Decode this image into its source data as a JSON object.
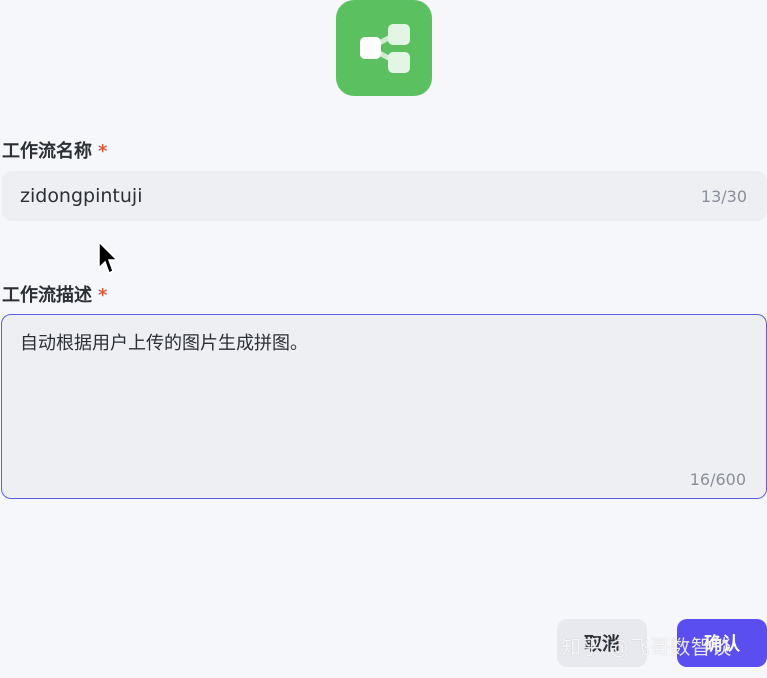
{
  "app_icon": {
    "name": "workflow-icon",
    "color": "#5ac060"
  },
  "workflow_name": {
    "label": "工作流名称",
    "required_mark": "*",
    "value": "zidongpintuji",
    "counter": "13/30"
  },
  "workflow_description": {
    "label": "工作流描述",
    "required_mark": "*",
    "value": "自动根据用户上传的图片生成拼图。",
    "counter": "16/600"
  },
  "buttons": {
    "cancel_label": "取消",
    "confirm_label": "确认"
  },
  "watermark": "知乎 @飞哥数智谈",
  "colors": {
    "accent": "#5b4ef0",
    "focus_border": "#5b62d6",
    "required": "#e05a3a"
  }
}
